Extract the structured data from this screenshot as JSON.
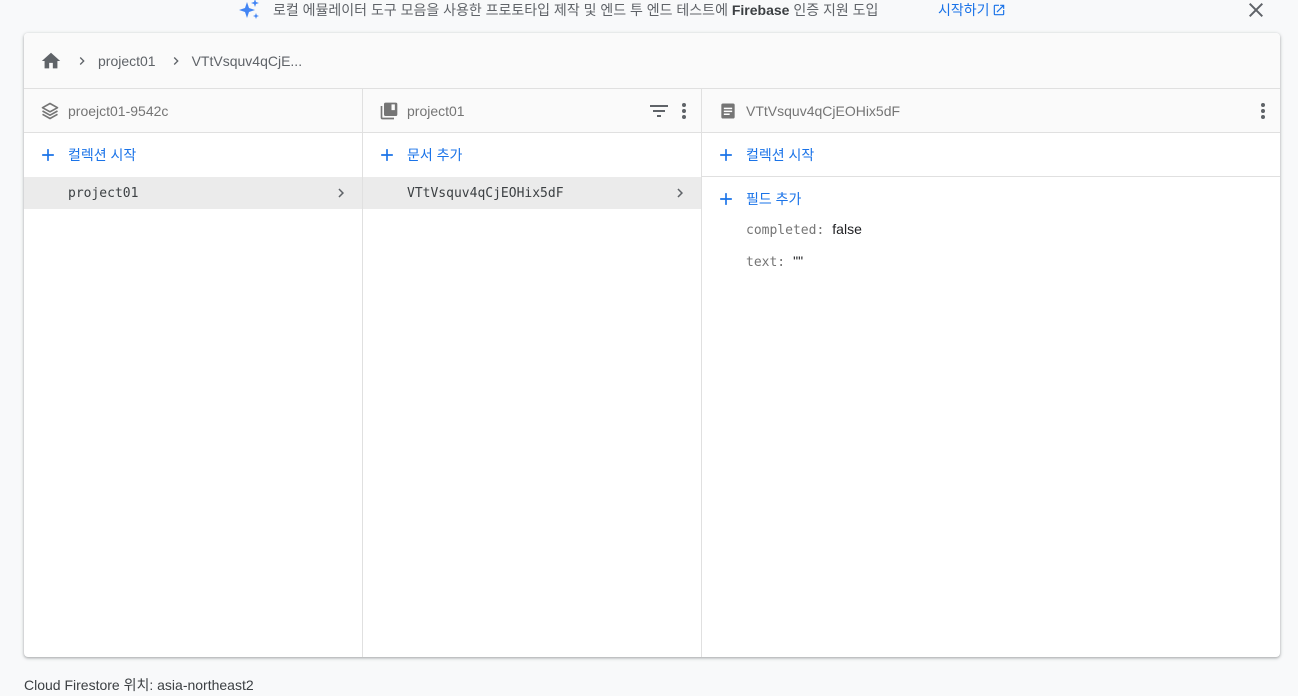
{
  "banner": {
    "text_before": "로컬 에뮬레이터 도구 모음을 사용한 프로토타입 제작 및 엔드 투 엔드 테스트에 ",
    "text_bold": "Firebase",
    "text_after": " 인증 지원 도입",
    "link_label": "시작하기",
    "icon": "sparkle-icon",
    "close_icon": "close-icon"
  },
  "breadcrumb": {
    "home_icon": "home-icon",
    "items": [
      "project01",
      "VTtVsquv4qCjE..."
    ]
  },
  "columns": [
    {
      "header": "proejct01-9542c",
      "header_icon": "database-stack-icon",
      "add_label": "컬렉션 시작",
      "items": [
        {
          "label": "project01",
          "selected": true
        }
      ]
    },
    {
      "header": "project01",
      "header_icon": "collection-icon",
      "add_label": "문서 추가",
      "items": [
        {
          "label": "VTtVsquv4qCjEOHix5dF",
          "selected": true
        }
      ]
    },
    {
      "header": "VTtVsquv4qCjEOHix5dF",
      "header_icon": "document-icon",
      "add_collection_label": "컬렉션 시작",
      "add_field_label": "필드 추가",
      "fields": [
        {
          "key": "completed:",
          "value": "false"
        },
        {
          "key": "text:",
          "value": "\"\""
        }
      ]
    }
  ],
  "footer": {
    "location_text": "Cloud Firestore 위치: asia-northeast2"
  },
  "colors": {
    "accent": "#1a73e8",
    "selected_row": "#ebebeb"
  }
}
